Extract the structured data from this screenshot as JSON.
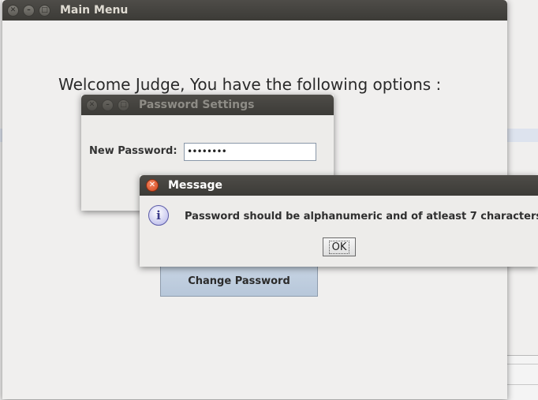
{
  "main_menu": {
    "title": "Main Menu",
    "welcome_text": "Welcome Judge, You have the following options :",
    "change_password_label": "Change Password"
  },
  "password_settings": {
    "title": "Password Settings",
    "new_password_label": "New Password:",
    "new_password_value": "••••••••"
  },
  "message_dialog": {
    "title": "Message",
    "message": "Password should be alphanumeric and of atleast 7 characters",
    "ok_label": "OK",
    "icon": "info-icon"
  },
  "colors": {
    "titlebar": "#3c3b37",
    "window_bg": "#edecea",
    "button_blue": "#b7c7da",
    "close_red": "#d3481f"
  }
}
